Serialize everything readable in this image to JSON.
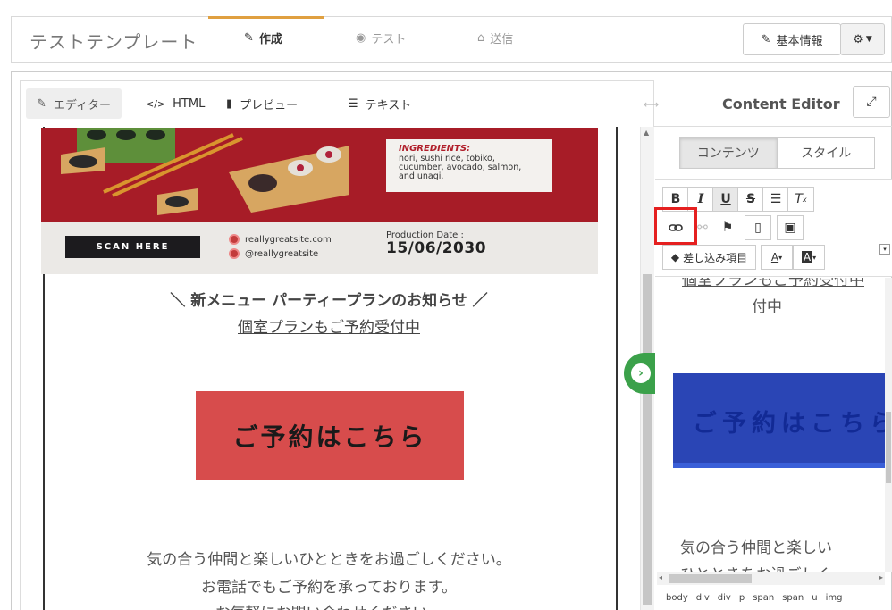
{
  "header": {
    "app_title": "テストテンプレート",
    "tabs": [
      {
        "label": "作成",
        "icon": "edit-icon",
        "active": true
      },
      {
        "label": "テスト",
        "icon": "target-icon",
        "active": false
      },
      {
        "label": "送信",
        "icon": "inbox-icon",
        "active": false
      }
    ],
    "basic_info_label": "基本情報",
    "settings_icon": "gear-icon"
  },
  "editor_tabs": [
    {
      "label": "エディター",
      "icon": "edit-icon",
      "active": true
    },
    {
      "label": "HTML",
      "icon": "code-icon",
      "active": false
    },
    {
      "label": "プレビュー",
      "icon": "file-icon",
      "active": false
    },
    {
      "label": "テキスト",
      "icon": "align-left-icon",
      "active": false
    }
  ],
  "banner": {
    "ingredients_title": "INGREDIENTS:",
    "ingredients_text": "nori, sushi rice, tobiko, cucumber, avocado, salmon, and unagi.",
    "scan_here": "SCAN HERE",
    "website": "reallygreatsite.com",
    "social": "@reallygreatsite",
    "production_label": "Production Date :",
    "production_date": "15/06/2030"
  },
  "email": {
    "headline": "＼ 新メニュー パーティープランのお知らせ ／",
    "subline": "個室プランもご予約受付中",
    "reserve_button": "ご予約はこちら",
    "para1": "気の合う仲間と楽しいひとときをお過ごしください。",
    "para2": "お電話でもご予約を承っております。",
    "para3": "お気軽にお問い合わせください。"
  },
  "content_editor": {
    "title": "Content Editor",
    "tabs": [
      {
        "label": "コンテンツ",
        "active": true
      },
      {
        "label": "スタイル",
        "active": false
      }
    ],
    "toolbar": {
      "bold": "B",
      "italic": "I",
      "underline": "U",
      "strike": "S",
      "merge_tag_label": "差し込み項目",
      "font_color": "A",
      "bg_color": "A"
    },
    "preview_link_text": "個室プランもご予約受付中",
    "preview_link_line2": "付中",
    "preview_button_text": "ご予約はこちら",
    "preview_para": "気の合う仲間と楽しい",
    "preview_para2": "ひとときをお過ごしく"
  },
  "element_path": [
    "body",
    "div",
    "div",
    "p",
    "span",
    "span",
    "u",
    "img"
  ],
  "colors": {
    "accent": "#e0a040",
    "banner_red": "#a71c27",
    "reserve_button": "#d74c4c",
    "preview_button": "#2a45b5",
    "collapse_button": "#3ba14a",
    "highlight": "#e52020"
  }
}
